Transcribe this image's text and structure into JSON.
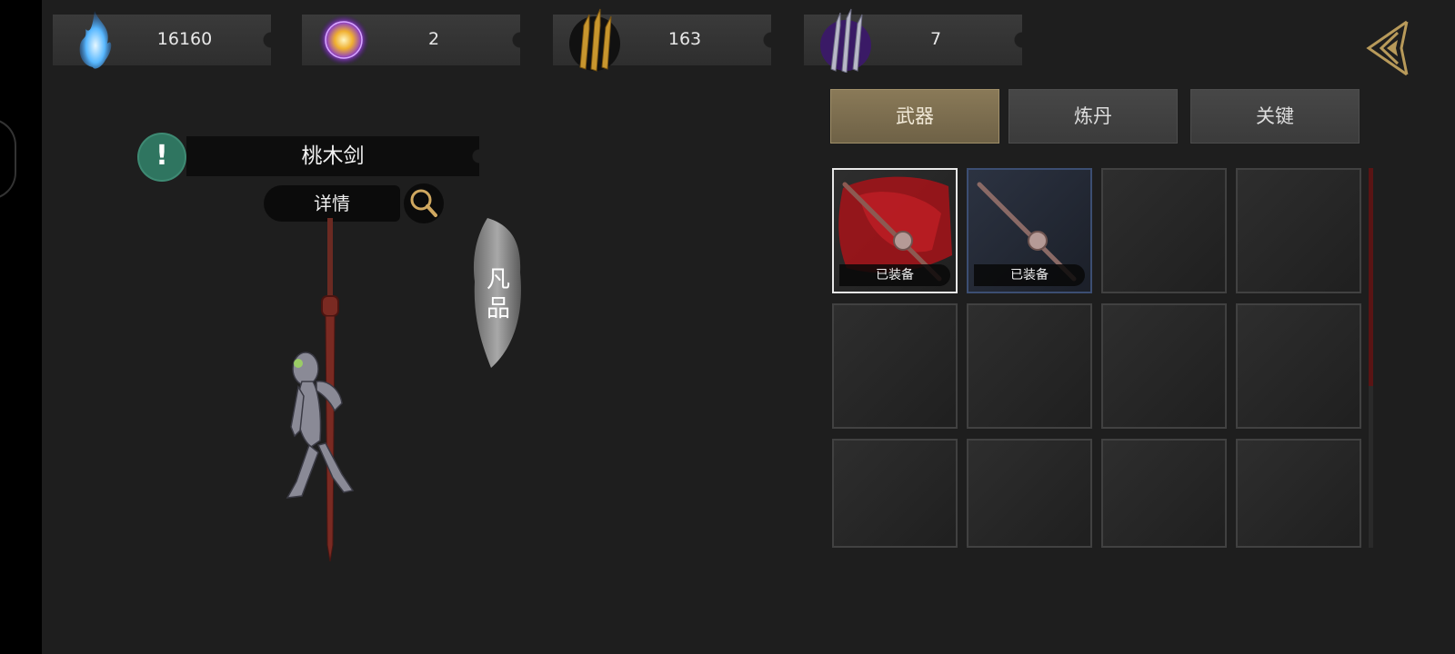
{
  "resources": [
    {
      "icon": "blue-flame-icon",
      "value": "16160"
    },
    {
      "icon": "purple-orb-icon",
      "value": "2"
    },
    {
      "icon": "gold-blades-icon",
      "value": "163"
    },
    {
      "icon": "purple-blades-icon",
      "value": "7"
    }
  ],
  "tabs": [
    {
      "label": "武器",
      "active": true
    },
    {
      "label": "炼丹",
      "active": false
    },
    {
      "label": "关键",
      "active": false
    }
  ],
  "item": {
    "name": "桃木剑",
    "details_label": "详情",
    "grade_line1": "凡",
    "grade_line2": "品"
  },
  "inventory": {
    "equipped_label": "已装备",
    "slots": [
      {
        "item": "peach-wood-sword",
        "equipped": true,
        "selected": true
      },
      {
        "item": "iron-sword",
        "equipped": true,
        "selected": false
      },
      {
        "item": null
      },
      {
        "item": null
      },
      {
        "item": null
      },
      {
        "item": null
      },
      {
        "item": null
      },
      {
        "item": null
      },
      {
        "item": null
      },
      {
        "item": null
      },
      {
        "item": null
      },
      {
        "item": null
      }
    ]
  },
  "colors": {
    "active_tab": "#7d6e50",
    "selected_slot_border": "#e8e8e8",
    "scrollbar_thumb": "#5a1414",
    "info_badge": "#2f7560"
  }
}
